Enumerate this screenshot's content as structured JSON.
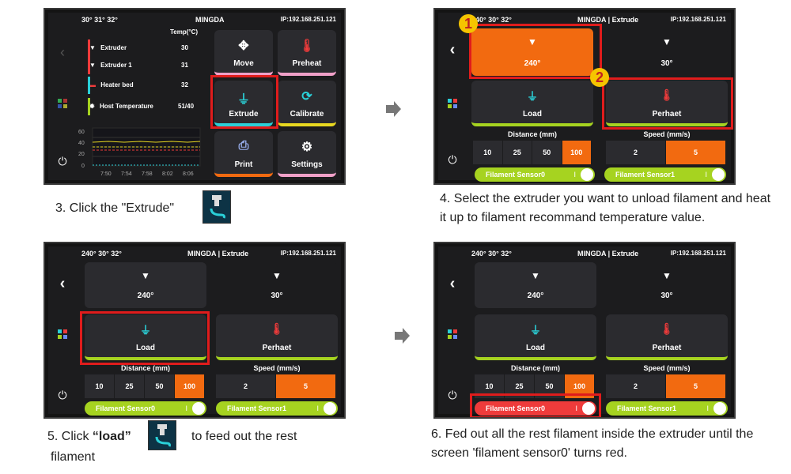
{
  "colors": {
    "accent": "#f26a10",
    "green": "#a6d320",
    "cyan": "#2ad0d8",
    "pink": "#f0a0c8",
    "yellow": "#e8d820",
    "red": "#ef3b3b",
    "dark": "#1c1c1e",
    "tile": "#2b2b2f"
  },
  "screen1": {
    "status_temps": "30° 31° 32°",
    "status_title": "MINGDA",
    "status_ip": "IP:192.168.251.121",
    "temp_header": "Temp(°C)",
    "sensors": [
      {
        "name": "Extruder",
        "value": "30",
        "icon": "nozzle-icon",
        "color": "#ef3b3b"
      },
      {
        "name": "Extruder 1",
        "value": "31",
        "icon": "nozzle-icon",
        "color": "#ef3b3b"
      },
      {
        "name": "Heater bed",
        "value": "32",
        "icon": "heater-bed-icon",
        "color": "#2ad0d8"
      },
      {
        "name": "Host Temperature",
        "value": "51/40",
        "icon": "gear-icon",
        "color": "#a6d320"
      }
    ],
    "chart_y_ticks": [
      "60",
      "40",
      "20",
      "0"
    ],
    "chart_x_ticks": [
      "7:50",
      "7:54",
      "7:58",
      "8:02",
      "8:06"
    ],
    "tiles": [
      {
        "label": "Move",
        "icon": "move-icon"
      },
      {
        "label": "Preheat",
        "icon": "thermometer-icon"
      },
      {
        "label": "Extrude",
        "icon": "extruder-icon"
      },
      {
        "label": "Calibrate",
        "icon": "calibrate-icon"
      },
      {
        "label": "Print",
        "icon": "print-icon"
      },
      {
        "label": "Settings",
        "icon": "gear-icon"
      }
    ]
  },
  "screen_ext": {
    "status_temps": "240° 30° 32°",
    "status_title": "MINGDA | Extrude",
    "status_ip": "IP:192.168.251.121",
    "extruder0_temp": "240°",
    "extruder1_temp": "30°",
    "load_label": "Load",
    "preheat_label": "Perhaet",
    "distance_label": "Distance (mm)",
    "speed_label": "Speed (mm/s)",
    "distances": [
      "10",
      "25",
      "50",
      "100"
    ],
    "speeds": [
      "2",
      "5"
    ],
    "sensor0_label": "Filament Sensor0",
    "sensor1_label": "Filament Sensor1",
    "toggle_mark": "I"
  },
  "badges": {
    "one": "1",
    "two": "2"
  },
  "captions": {
    "step3": "3. Click the \"Extrude\"",
    "step4": "4. Select the extruder you want to unload filament and heat it up to filament recommand temperature value.",
    "step5_a": "5. Click ",
    "step5_b": "“load”",
    "step5_c": "to feed out the rest",
    "step5_d": "filament",
    "step6": "6. Fed out all the rest filament inside the extruder until the screen 'filament sensor0' turns red."
  }
}
